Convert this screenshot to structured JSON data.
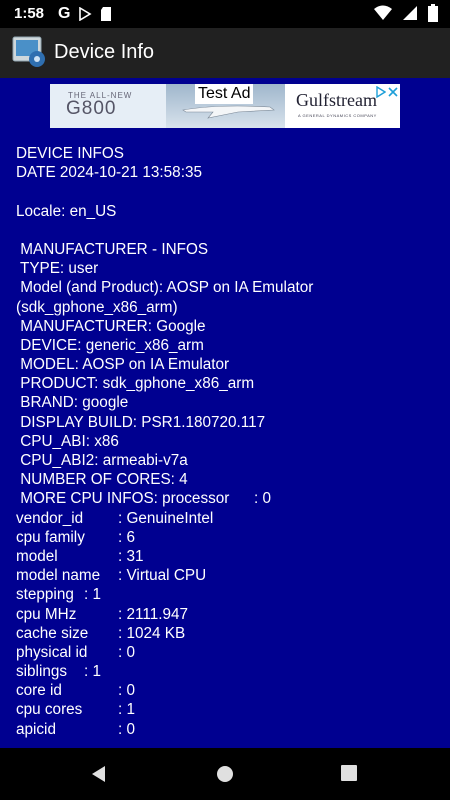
{
  "status_bar": {
    "time": "1:58",
    "icons": [
      "google-icon",
      "play-store-icon",
      "sd-card-icon",
      "wifi-icon",
      "signal-icon",
      "battery-icon"
    ]
  },
  "app_bar": {
    "title": "Device Info",
    "icon": "device-info-logo-icon"
  },
  "ad": {
    "label": "Test Ad",
    "left_tagline": "THE ALL-NEW",
    "left_model": "G800",
    "right_brand": "Gulfstream",
    "right_sub": "A GENERAL DYNAMICS COMPANY",
    "badge_icons": [
      "adchoices-icon",
      "close-icon"
    ]
  },
  "info_lines": [
    "DEVICE INFOS",
    "DATE 2024-10-21 13:58:35",
    "",
    "Locale: en_US",
    "",
    " MANUFACTURER - INFOS",
    " TYPE: user",
    " Model (and Product): AOSP on IA Emulator",
    "(sdk_gphone_x86_arm)",
    " MANUFACTURER: Google",
    " DEVICE: generic_x86_arm",
    " MODEL: AOSP on IA Emulator",
    " PRODUCT: sdk_gphone_x86_arm",
    " BRAND: google",
    " DISPLAY BUILD: PSR1.180720.117",
    " CPU_ABI: x86",
    " CPU_ABI2: armeabi-v7a",
    " NUMBER OF CORES: 4",
    " MORE CPU INFOS: processor\t: 0",
    "vendor_id\t: GenuineIntel",
    "cpu family\t: 6",
    "model\t\t: 31",
    "model name\t: Virtual CPU",
    "stepping\t: 1",
    "cpu MHz\t\t: 2111.947",
    "cache size\t: 1024 KB",
    "physical id\t: 0",
    "siblings\t: 1",
    "core id\t\t: 0",
    "cpu cores\t: 1",
    "apicid\t\t: 0"
  ],
  "nav_bar": {
    "back": "back-icon",
    "home": "home-icon",
    "recents": "recents-icon"
  }
}
